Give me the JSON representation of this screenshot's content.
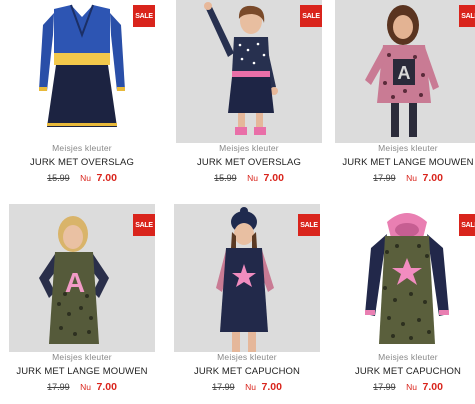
{
  "sale_badge": "SALE",
  "colors": {
    "sale_red": "#d9241c",
    "price_red": "#d9241c"
  },
  "products": [
    {
      "category": "Meisjes kleuter",
      "title": "JURK MET OVERSLAG",
      "old_price": "15.99",
      "now_label": "Nu",
      "price": "7.00"
    },
    {
      "category": "Meisjes kleuter",
      "title": "JURK MET OVERSLAG",
      "old_price": "15.99",
      "now_label": "Nu",
      "price": "7.00"
    },
    {
      "category": "Meisjes kleuter",
      "title": "JURK MET LANGE MOUWEN",
      "old_price": "17.99",
      "now_label": "Nu",
      "price": "7.00"
    },
    {
      "category": "Meisjes kleuter",
      "title": "JURK MET LANGE MOUWEN",
      "old_price": "17.99",
      "now_label": "Nu",
      "price": "7.00"
    },
    {
      "category": "Meisjes kleuter",
      "title": "JURK MET CAPUCHON",
      "old_price": "17.99",
      "now_label": "Nu",
      "price": "7.00"
    },
    {
      "category": "Meisjes kleuter",
      "title": "JURK MET CAPUCHON",
      "old_price": "17.99",
      "now_label": "Nu",
      "price": "7.00"
    }
  ]
}
